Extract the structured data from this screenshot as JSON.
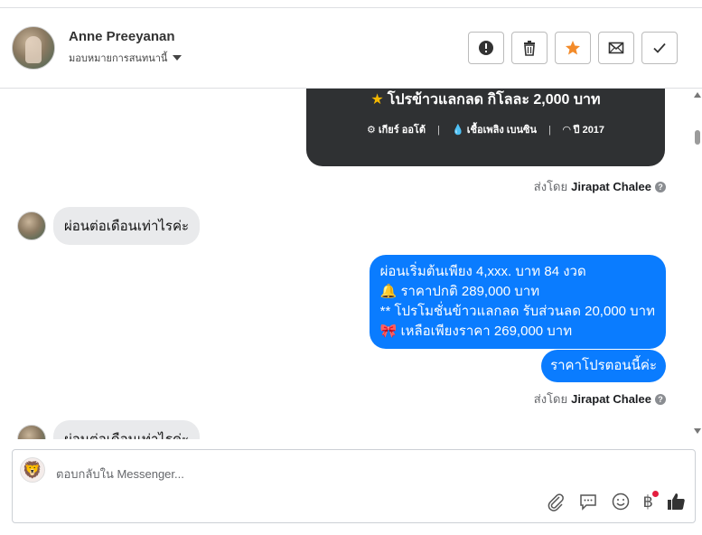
{
  "header": {
    "contact_name": "Anne Preeyanan",
    "assign_label": "มอบหมายการสนทนานี้",
    "buttons": [
      "mark-spam",
      "delete",
      "star",
      "mark-unread",
      "mark-done"
    ]
  },
  "chat": {
    "card": {
      "title": "โปรข้าวแลกลด กิโลละ 2,000 บาท",
      "meta_gear": "เกียร์ ออโต้",
      "meta_fuel": "เชื้อเพลิง เบนซิน",
      "meta_year": "ปี 2017"
    },
    "sent_by_prefix": "ส่งโดย",
    "sent_by_name": "Jirapat Chalee",
    "incoming_1": "ผ่อนต่อเดือนเท่าไรค่ะ",
    "outgoing_lines": [
      "ผ่อนเริ่มต้นเพียง 4,xxx. บาท 84 งวด",
      "🔔 ราคาปกติ 289,000 บาท",
      "** โปรโมชั่นข้าวแลกลด รับส่วนลด 20,000 บาท",
      "🎀  เหลือเพียงราคา 269,000 บาท"
    ],
    "outgoing_2": "ราคาโปรตอนนี้ค่ะ",
    "incoming_2": "ผ่อนต่อเดือนเท่าไรค่ะ"
  },
  "composer": {
    "placeholder": "ตอบกลับใน Messenger...",
    "currency_symbol": "฿"
  },
  "colors": {
    "outgoing_bubble": "#0a7cff",
    "incoming_bubble": "#e9eaec",
    "card_bg": "#2f3133",
    "star": "#f38b2a"
  }
}
